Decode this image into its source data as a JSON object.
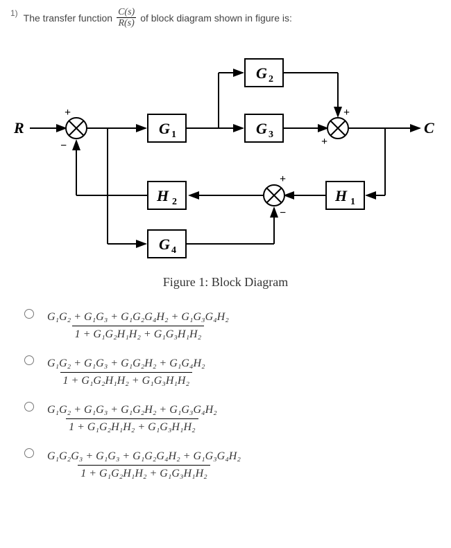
{
  "question": {
    "number": "1)",
    "text_pre": "The transfer function",
    "cs": "C(s)",
    "rs": "R(s)",
    "text_post": "of block diagram shown in figure is:"
  },
  "diagram": {
    "R": "R",
    "C": "C",
    "G1": "G",
    "G1_sub": "1",
    "G2": "G",
    "G2_sub": "2",
    "G3": "G",
    "G3_sub": "3",
    "G4": "G",
    "G4_sub": "4",
    "H1": "H",
    "H1_sub": "1",
    "H2": "H",
    "H2_sub": "2",
    "plus": "+",
    "minus": "−",
    "caption": "Figure 1: Block Diagram"
  },
  "options": [
    {
      "num": "G₁G₂ + G₁G₃ + G₁G₂G₄H₂ + G₁G₃G₄H₂",
      "den": "1 + G₁G₂H₁H₂ + G₁G₃H₁H₂"
    },
    {
      "num": "G₁G₂ + G₁G₃ + G₁G₂H₂ + G₁G₄H₂",
      "den": "1 + G₁G₂H₁H₂ + G₁G₃H₁H₂"
    },
    {
      "num": "G₁G₂ + G₁G₃ + G₁G₂H₂ + G₁G₃G₄H₂",
      "den": "1 + G₁G₂H₁H₂ + G₁G₃H₁H₂"
    },
    {
      "num": "G₁G₂G₃ + G₁G₃ + G₁G₂G₄H₂ + G₁G₃G₄H₂",
      "den": "1 + G₁G₂H₁H₂ + G₁G₃H₁H₂"
    }
  ]
}
